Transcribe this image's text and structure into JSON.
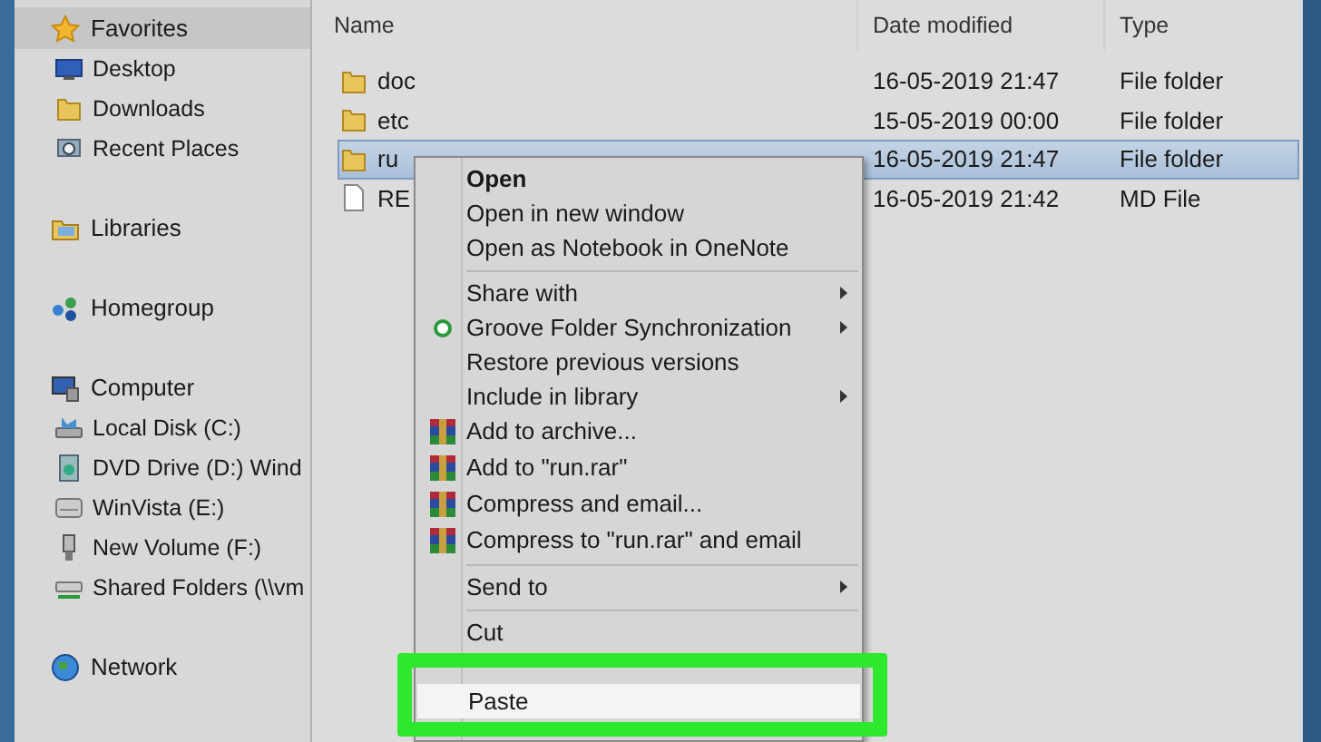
{
  "sidebar": {
    "groups": [
      {
        "label": "Favorites",
        "selected": true,
        "children": [
          {
            "label": "Desktop"
          },
          {
            "label": "Downloads"
          },
          {
            "label": "Recent Places"
          }
        ]
      },
      {
        "label": "Libraries",
        "selected": false
      },
      {
        "label": "Homegroup",
        "selected": false
      },
      {
        "label": "Computer",
        "selected": false,
        "children": [
          {
            "label": "Local Disk (C:)"
          },
          {
            "label": "DVD Drive (D:) Wind"
          },
          {
            "label": "WinVista (E:)"
          },
          {
            "label": "New Volume (F:)"
          },
          {
            "label": "Shared Folders (\\\\vm"
          }
        ]
      },
      {
        "label": "Network",
        "selected": false
      }
    ]
  },
  "file_list": {
    "columns": [
      "Name",
      "Date modified",
      "Type"
    ],
    "rows": [
      {
        "kind": "folder",
        "name": "doc",
        "date": "16-05-2019 21:47",
        "type": "File folder",
        "selected": false
      },
      {
        "kind": "folder",
        "name": "etc",
        "date": "15-05-2019 00:00",
        "type": "File folder",
        "selected": false
      },
      {
        "kind": "folder",
        "name": "ru",
        "date": "16-05-2019 21:47",
        "type": "File folder",
        "selected": true
      },
      {
        "kind": "file",
        "name": "RE",
        "date": "16-05-2019 21:42",
        "type": "MD File",
        "selected": false
      }
    ]
  },
  "context_menu": {
    "items": [
      {
        "kind": "plain",
        "label": "Open",
        "default": true
      },
      {
        "kind": "plain",
        "label": "Open in new window",
        "default": false
      },
      {
        "kind": "plain",
        "label": "Open as Notebook in OneNote",
        "default": false
      },
      {
        "kind": "separator"
      },
      {
        "kind": "plain",
        "label": "Share with",
        "submenu": true
      },
      {
        "kind": "sync",
        "label": "Groove Folder Synchronization",
        "submenu": true
      },
      {
        "kind": "plain",
        "label": "Restore previous versions",
        "submenu": false
      },
      {
        "kind": "plain",
        "label": "Include in library",
        "submenu": true
      },
      {
        "kind": "archive",
        "label": "Add to archive..."
      },
      {
        "kind": "archive",
        "label": "Add to \"run.rar\""
      },
      {
        "kind": "archive",
        "label": "Compress and email..."
      },
      {
        "kind": "archive",
        "label": "Compress to \"run.rar\" and email"
      },
      {
        "kind": "separator"
      },
      {
        "kind": "plain",
        "label": "Send to",
        "submenu": true
      },
      {
        "kind": "separator"
      },
      {
        "kind": "plain",
        "label": "Cut",
        "highlighted": false
      },
      {
        "kind": "plain",
        "label": "Paste",
        "highlighted": true
      }
    ]
  }
}
